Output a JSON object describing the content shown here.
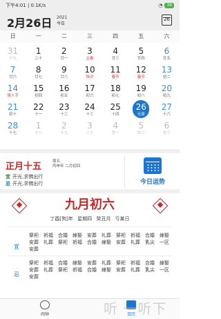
{
  "status_bar": {
    "time": "下午4:01",
    "speed": "0.1K/s",
    "battery": "39"
  },
  "header": {
    "date": "2月26日",
    "year": "2021",
    "today": "今日",
    "calendar_button": "26"
  },
  "weekdays": [
    "日",
    "一",
    "二",
    "三",
    "四",
    "五",
    "六"
  ],
  "weeks": [
    [
      {
        "n": "31",
        "s": "十九",
        "st": "dim"
      },
      {
        "n": "1",
        "s": "二十"
      },
      {
        "n": "2",
        "s": "廿一"
      },
      {
        "n": "3",
        "s": "立春",
        "st": "red"
      },
      {
        "n": "4",
        "s": "廿三"
      },
      {
        "n": "5",
        "s": "廿四"
      },
      {
        "n": "6",
        "s": "廿五",
        "st": "blue"
      }
    ],
    [
      {
        "n": "7",
        "s": "廿六",
        "st": "blue"
      },
      {
        "n": "8",
        "s": "廿七"
      },
      {
        "n": "9",
        "s": "廿八"
      },
      {
        "n": "10",
        "s": "除夕",
        "st": "red"
      },
      {
        "n": "11",
        "s": "春节",
        "st": "red"
      },
      {
        "n": "12",
        "s": "春节",
        "st": "red"
      },
      {
        "n": "13",
        "s": "初二",
        "st": "blue"
      }
    ],
    [
      {
        "n": "14",
        "s": "情人节",
        "st": "blue red"
      },
      {
        "n": "15",
        "s": "初四"
      },
      {
        "n": "16",
        "s": "初五"
      },
      {
        "n": "17",
        "s": "初六"
      },
      {
        "n": "18",
        "s": "初七"
      },
      {
        "n": "19",
        "s": "初八"
      },
      {
        "n": "20",
        "s": "初九",
        "st": "blue"
      }
    ],
    [
      {
        "n": "21",
        "s": "初十",
        "st": "blue"
      },
      {
        "n": "22",
        "s": "十一"
      },
      {
        "n": "23",
        "s": "十二"
      },
      {
        "n": "24",
        "s": "十三"
      },
      {
        "n": "25",
        "s": "十四"
      },
      {
        "n": "26",
        "s": "元宵",
        "st": "sel"
      },
      {
        "n": "27",
        "s": "十六",
        "st": "blue"
      }
    ],
    [
      {
        "n": "28",
        "s": "十七",
        "st": "blue"
      },
      {
        "n": "1",
        "s": "十八",
        "st": "dim"
      },
      {
        "n": "2",
        "s": "十九",
        "st": "dim"
      },
      {
        "n": "3",
        "s": "二十",
        "st": "dim"
      },
      {
        "n": "4",
        "s": "廿一",
        "st": "dim"
      },
      {
        "n": "5",
        "s": "廿二",
        "st": "dim"
      },
      {
        "n": "6",
        "s": "廿三",
        "st": "dim"
      }
    ]
  ],
  "lunar": {
    "day": "正月十五",
    "weekday": "周五",
    "ganzhi": "丙申年 二月初四",
    "yi_label": "宜",
    "yi_text": "开光,求佛出行",
    "ji_label": "忌",
    "ji_text": "开光,求佛出行"
  },
  "fortune": {
    "label": "今日运势"
  },
  "almanac": {
    "title": "九月初六",
    "subtitle": "丁酉[狗]年 星期四 癸丑月 亏某日",
    "yi_label": "宜",
    "ji_label": "忌",
    "yi_items": [
      "祭祀",
      "祈福",
      "合婚",
      "嫁娶",
      "安葬",
      "礼葬",
      "祭祀",
      "祈福",
      "合婚",
      "嫁娶",
      "安葬",
      "礼葬",
      "祭祀",
      "祈福",
      "合婚",
      "嫁娶",
      "安葬",
      "礼葬",
      "乳尖",
      "一区",
      "安葬"
    ],
    "ji_items": [
      "祭祀",
      "祈福",
      "合婚",
      "嫁娶",
      "安葬",
      "礼葬",
      "祭祀",
      "祈福",
      "合婚",
      "嫁娶",
      "安葬",
      "礼葬",
      "祭祀",
      "祈福",
      "合婚",
      "嫁娶",
      "安葬",
      "礼葬",
      "乳尖",
      "一区",
      "安葬"
    ]
  },
  "tabs": {
    "alarm": "闹钟",
    "calendar": "日历"
  },
  "watermark": "听 一听下载"
}
